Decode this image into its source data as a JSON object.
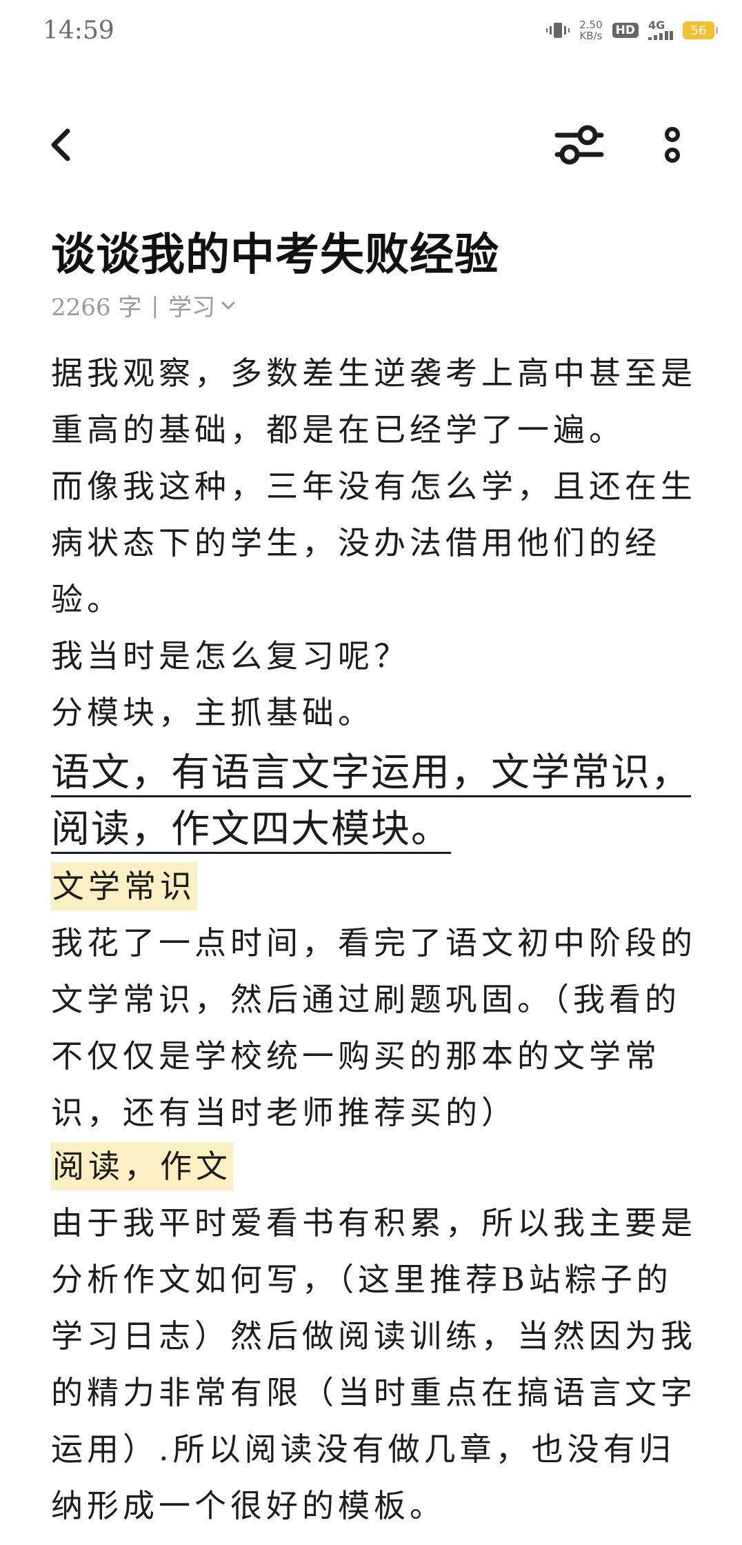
{
  "status_bar": {
    "time": "14:59",
    "net_speed_value": "2.50",
    "net_speed_unit": "KB/s",
    "hd_badge": "HD",
    "network": "4G",
    "battery": "56"
  },
  "toolbar": {
    "back_icon": "chevron-left-icon",
    "filter_icon": "sliders-icon",
    "more_icon": "more-vertical-icon"
  },
  "article": {
    "title": "谈谈我的中考失败经验",
    "word_count": "2266 字",
    "separator": "|",
    "category": "学习",
    "paragraphs": [
      "据我观察，多数差生逆袭考上高中甚至是重高的基础，都是在已经学了一遍。",
      "而像我这种，三年没有怎么学，且还在生病状态下的学生，没办法借用他们的经验。",
      "我当时是怎么复习呢？",
      "分模块，主抓基础。"
    ],
    "heading": "语文，有语言文字运用，文学常识，阅读，作文四大模块。",
    "section1_title": "文学常识",
    "section1_text": "我花了一点时间，看完了语文初中阶段的文学常识，然后通过刷题巩固。（我看的不仅仅是学校统一购买的那本的文学常识，还有当时老师推荐买的）",
    "section2_title": "阅读，作文",
    "section2_text": "由于我平时爱看书有积累，所以我主要是分析作文如何写，（这里推荐B站粽子的学习日志）然后做阅读训练，当然因为我的精力非常有限（当时重点在搞语言文字运用）.所以阅读没有做几章，也没有归纳形成一个很好的模板。"
  },
  "colors": {
    "highlight": "#fbefc4",
    "battery": "#f2c12e",
    "meta_text": "#9a9a9a"
  }
}
